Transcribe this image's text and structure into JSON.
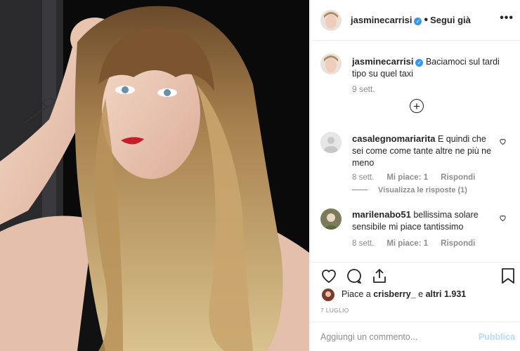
{
  "post": {
    "username": "jasminecarrisi",
    "follow_status": "Segui già",
    "more_icon": "ellipsis-icon",
    "caption_text": "Baciamoci sul tardi tipo su quel taxi",
    "caption_time": "9 sett.",
    "comments": [
      {
        "username": "casalegnomariarita",
        "text": "E quindi che sei come come tante altre ne più ne meno",
        "time": "8 sett.",
        "likes": "Mi piace: 1",
        "reply": "Rispondi",
        "view_replies": "Visualizza le risposte (1)"
      },
      {
        "username": "marilenabo51",
        "text": "bellissima solare sensibile mi piace tantissimo",
        "time": "8 sett.",
        "likes": "Mi piace: 1",
        "reply": "Rispondi"
      }
    ],
    "likes_prefix": "Piace a",
    "likes_user": "crisberry_",
    "likes_joiner": "e",
    "likes_others": "altri 1.931",
    "date": "7 LUGLIO",
    "comment_placeholder": "Aggiungi un commento...",
    "publish_label": "Pubblica"
  },
  "colors": {
    "verified": "#3897f0",
    "muted": "#8e8e8e",
    "publish_disabled": "#b3dbff"
  }
}
